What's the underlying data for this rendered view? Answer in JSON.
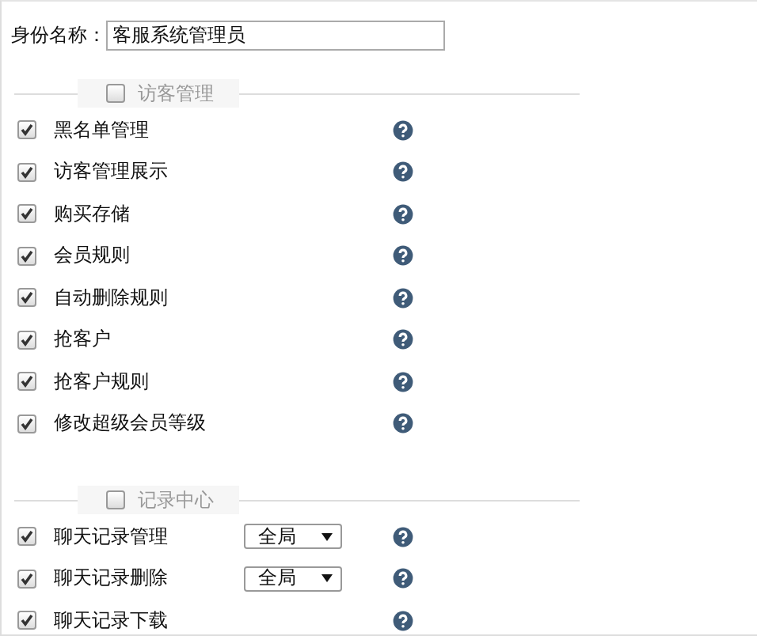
{
  "identity": {
    "label": "身份名称：",
    "value": "客服系统管理员"
  },
  "sections": [
    {
      "title": "访客管理",
      "checked": false,
      "items": [
        {
          "label": "黑名单管理",
          "checked": true
        },
        {
          "label": "访客管理展示",
          "checked": true
        },
        {
          "label": "购买存储",
          "checked": true
        },
        {
          "label": "会员规则",
          "checked": true
        },
        {
          "label": "自动删除规则",
          "checked": true
        },
        {
          "label": "抢客户",
          "checked": true
        },
        {
          "label": "抢客户规则",
          "checked": true
        },
        {
          "label": "修改超级会员等级",
          "checked": true
        }
      ]
    },
    {
      "title": "记录中心",
      "checked": false,
      "items": [
        {
          "label": "聊天记录管理",
          "checked": true,
          "scope": "全局"
        },
        {
          "label": "聊天记录删除",
          "checked": true,
          "scope": "全局"
        },
        {
          "label": "聊天记录下载",
          "checked": true
        }
      ]
    }
  ]
}
